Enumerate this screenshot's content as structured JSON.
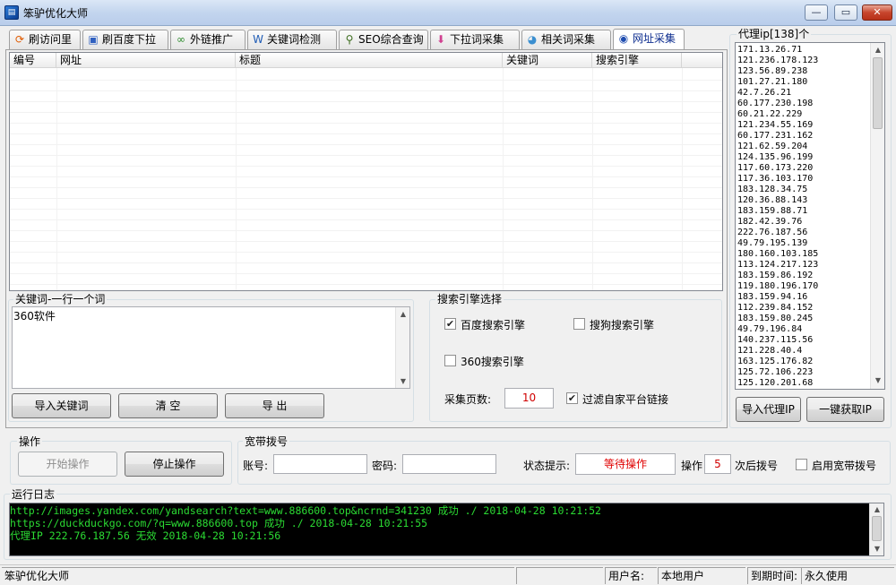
{
  "window": {
    "title": "笨驴优化大师",
    "app_icon": "app-icon",
    "minimize_icon": "minimize-icon",
    "maximize_icon": "maximize-icon",
    "close_icon": "close-icon"
  },
  "tabs": [
    {
      "label": "刷访问里",
      "icon": "refresh-icon",
      "icon_glyph": "⟳",
      "icon_color": "#e05a00"
    },
    {
      "label": "刷百度下拉",
      "icon": "baidu-icon",
      "icon_glyph": "▣",
      "icon_color": "#3060c0"
    },
    {
      "label": "外链推广",
      "icon": "link-icon",
      "icon_glyph": "∞",
      "icon_color": "#2a8a2a"
    },
    {
      "label": "关键词检测",
      "icon": "word-w-icon",
      "icon_glyph": "W",
      "icon_color": "#1e5bb5"
    },
    {
      "label": "SEO综合查询",
      "icon": "search-icon",
      "icon_glyph": "⚲",
      "icon_color": "#3a6b1b"
    },
    {
      "label": "下拉词采集",
      "icon": "down-arrow-icon",
      "icon_glyph": "⬇",
      "icon_color": "#d04090"
    },
    {
      "label": "相关词采集",
      "icon": "globe-icon",
      "icon_glyph": "◕",
      "icon_color": "#3b8fd0"
    },
    {
      "label": "网址采集",
      "icon": "url-globe-icon",
      "icon_glyph": "◉",
      "icon_color": "#1f4db0",
      "active": true
    }
  ],
  "grid": {
    "columns": [
      "编号",
      "网址",
      "标题",
      "关键词",
      "搜索引擎"
    ],
    "rows": []
  },
  "keywords": {
    "group_label": "关键词-一行一个词",
    "value": "360软件",
    "import_button": "导入关键词",
    "clear_button": "清 空",
    "export_button": "导 出"
  },
  "engine": {
    "group_label": "搜索引擎选择",
    "baidu_label": "百度搜索引擎",
    "baidu_checked": true,
    "sogou_label": "搜狗搜索引擎",
    "sogou_checked": false,
    "e360_label": "360搜索引擎",
    "e360_checked": false,
    "pages_label": "采集页数:",
    "pages_value": "10",
    "filter_label": "过滤自家平台链接",
    "filter_checked": true
  },
  "proxy": {
    "group_label": "代理ip[138]个",
    "list": [
      "171.13.26.71",
      "121.236.178.123",
      "123.56.89.238",
      "101.27.21.180",
      "42.7.26.21",
      "60.177.230.198",
      "60.21.22.229",
      "121.234.55.169",
      "60.177.231.162",
      "121.62.59.204",
      "124.135.96.199",
      "117.60.173.220",
      "117.36.103.170",
      "183.128.34.75",
      "120.36.88.143",
      "183.159.88.71",
      "182.42.39.76",
      "222.76.187.56",
      "49.79.195.139",
      "180.160.103.185",
      "113.124.217.123",
      "183.159.86.192",
      "119.180.196.170",
      "183.159.94.16",
      "112.239.84.152",
      "183.159.80.245",
      "49.79.196.84",
      "140.237.115.56",
      "121.228.40.4",
      "163.125.176.82",
      "125.72.106.223",
      "125.120.201.68"
    ],
    "import_button": "导入代理IP",
    "fetch_button": "一键获取IP"
  },
  "operation": {
    "group_label": "操作",
    "start_button": "开始操作",
    "stop_button": "停止操作"
  },
  "broadband": {
    "group_label": "宽带拨号",
    "account_label": "账号:",
    "account_value": "",
    "password_label": "密码:",
    "password_value": "",
    "status_label": "状态提示:",
    "status_value": "等待操作",
    "status_color": "#e00000",
    "op_label": "操作",
    "op_count": "5",
    "after_label": "次后拨号",
    "enable_label": "启用宽带拨号",
    "enable_checked": false
  },
  "log": {
    "group_label": "运行日志",
    "lines": [
      "http://images.yandex.com/yandsearch?text=www.886600.top&ncrnd=341230  成功 ./ 2018-04-28 10:21:52",
      "https://duckduckgo.com/?q=www.886600.top  成功 ./ 2018-04-28 10:21:55",
      "代理IP 222.76.187.56 无效 2018-04-28 10:21:56"
    ],
    "text_color": "#2bdb33"
  },
  "statusbar": {
    "app_name": "笨驴优化大师",
    "username_label": "用户名:",
    "username_value": "本地用户",
    "expire_label": "到期时间:",
    "expire_value": "永久使用"
  }
}
